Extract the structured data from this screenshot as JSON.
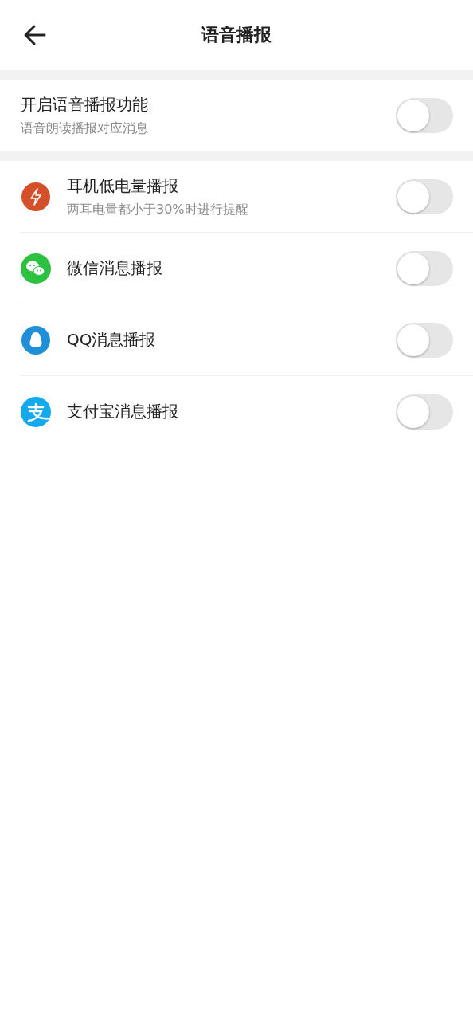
{
  "header": {
    "title": "语音播报"
  },
  "master": {
    "label": "开启语音播报功能",
    "description": "语音朗读播报对应消息",
    "on": false
  },
  "items": [
    {
      "kind": "bolt",
      "color": "#d4502a",
      "label": "耳机低电量播报",
      "description": "两耳电量都小于30%时进行提醒",
      "on": false
    },
    {
      "kind": "chat",
      "color": "#2dc140",
      "label": "微信消息播报",
      "on": false
    },
    {
      "kind": "penguin",
      "color": "#1e8fd8",
      "label": "QQ消息播报",
      "on": false
    },
    {
      "kind": "pay",
      "color": "#12a9ef",
      "label": "支付宝消息播报",
      "on": false
    }
  ]
}
